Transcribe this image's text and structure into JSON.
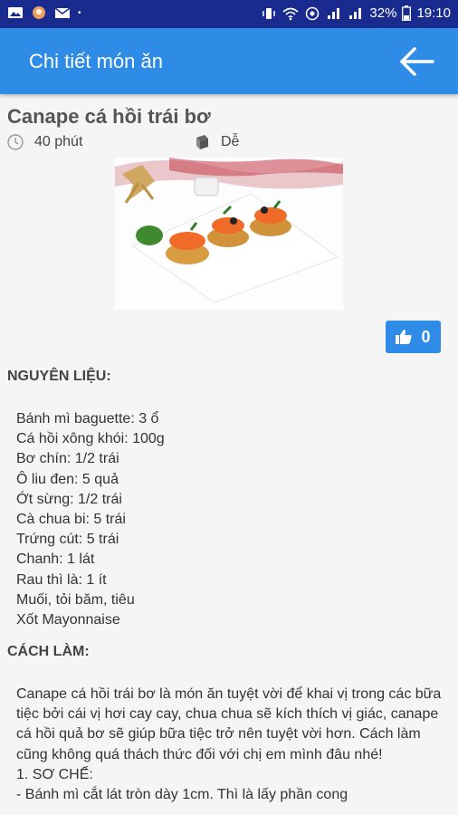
{
  "status_bar": {
    "battery": "32%",
    "time": "19:10",
    "icons": [
      "photo-icon",
      "avatar-icon",
      "mail-icon",
      "dot-icon",
      "vibrate-icon",
      "wifi-icon",
      "hotspot-icon",
      "signal-icon",
      "signal-icon",
      "battery-icon"
    ]
  },
  "app_bar": {
    "title": "Chi tiết món ăn",
    "back_icon": "arrow-left-icon"
  },
  "recipe": {
    "title": "Canape cá hồi trái bơ",
    "time": "40 phút",
    "difficulty": "Dễ",
    "likes": "0"
  },
  "ingredients": {
    "heading": "NGUYÊN LIỆU:",
    "items": [
      "Bánh mì baguette: 3 ổ",
      "Cá hồi xông khói: 100g",
      "Bơ chín: 1/2 trái",
      "Ô liu đen: 5 quả",
      "Ớt sừng: 1/2 trái",
      "Cà chua bi: 5 trái",
      "Trứng cút: 5 trái",
      "Chanh: 1 lát",
      "Rau thì là: 1 ít",
      "Muối, tỏi băm, tiêu",
      "Xốt Mayonnaise"
    ]
  },
  "method": {
    "heading": "CÁCH LÀM:",
    "paragraph": "Canape cá hồi trái bơ là món ăn tuyệt vời để khai vị trong các bữa tiệc bởi cái vị hơi cay cay, chua chua sẽ kích thích vị giác, canape cá hồi quả bơ sẽ giúp bữa tiệc trở nên tuyệt vời hơn. Cách làm cũng không quá thách thức đối với chị em mình đâu nhé!",
    "step_heading": "1. SƠ CHẾ:",
    "step_text": "- Bánh mì cắt lát tròn dày 1cm. Thì là lấy phần cong"
  },
  "colors": {
    "status_bar": "#1a2b8f",
    "app_bar": "#2e8be6",
    "background": "#f5f5f5"
  }
}
